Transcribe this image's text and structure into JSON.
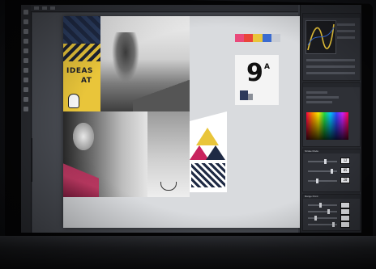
{
  "document": {
    "ideas_text_line1": "IDEAS",
    "ideas_text_line2": "AT",
    "card_number": "9",
    "card_superscript": "A"
  },
  "swatches": [
    "#e9497a",
    "#e9453a",
    "#e9c53a",
    "#3a6bd0",
    "#c8ccd4"
  ],
  "right_panels": {
    "curves_title": "",
    "color_title": "",
    "panel3_title": "Stroke Mode",
    "panel3_values": [
      "12",
      "85",
      "20"
    ],
    "panel4_title": "Range Point",
    "panel4_values": [
      "",
      "",
      "",
      ""
    ]
  },
  "colors": {
    "accent_yellow": "#e9c53a",
    "accent_magenta": "#c8245e",
    "navy": "#1f2a44"
  }
}
